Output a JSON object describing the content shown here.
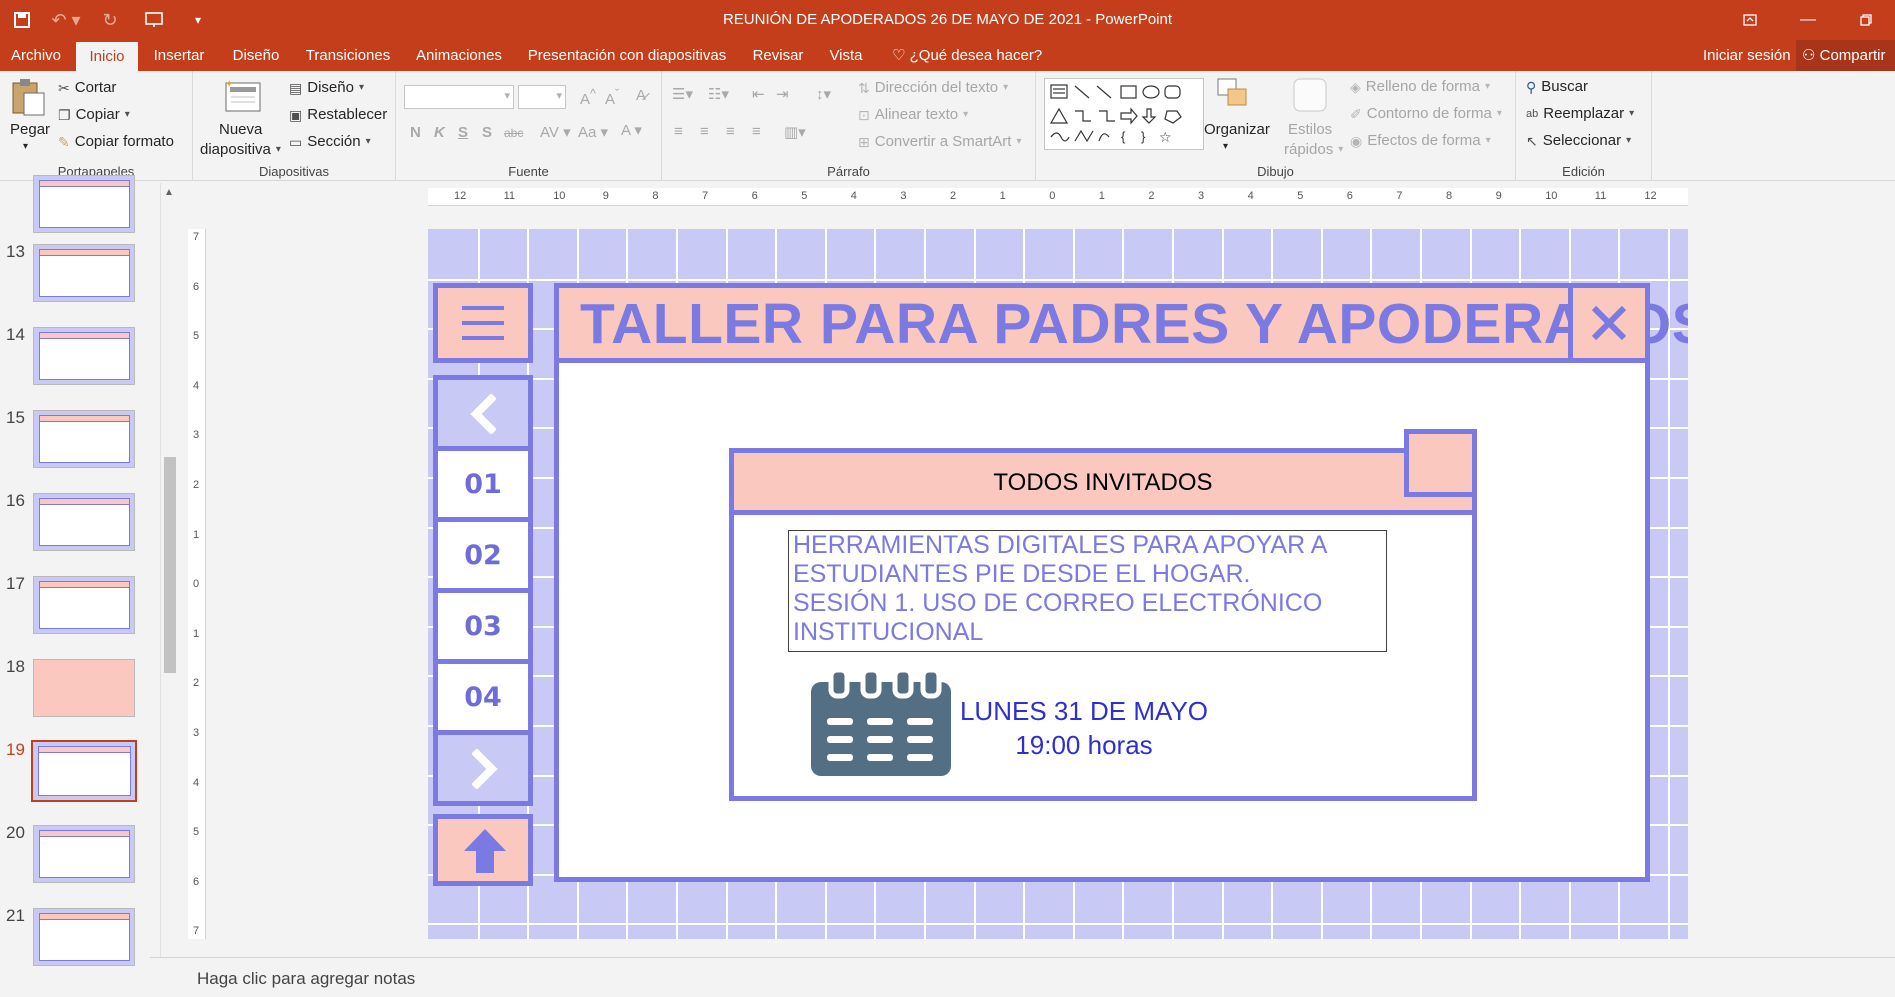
{
  "window": {
    "title": "REUNIÓN DE APODERADOS 26 DE MAYO DE 2021 - PowerPoint",
    "sign_in": "Iniciar sesión",
    "share": "Compartir"
  },
  "tabs": [
    "Archivo",
    "Inicio",
    "Insertar",
    "Diseño",
    "Transiciones",
    "Animaciones",
    "Presentación con diapositivas",
    "Revisar",
    "Vista"
  ],
  "active_tab": "Inicio",
  "tell_me": "¿Qué desea hacer?",
  "ribbon": {
    "clipboard": {
      "paste": "Pegar",
      "cut": "Cortar",
      "copy": "Copiar",
      "format_painter": "Copiar formato",
      "label": "Portapapeles"
    },
    "slides": {
      "new_slide_1": "Nueva",
      "new_slide_2": "diapositiva",
      "layout": "Diseño",
      "reset": "Restablecer",
      "section": "Sección",
      "label": "Diapositivas"
    },
    "font": {
      "label": "Fuente"
    },
    "paragraph": {
      "text_direction": "Dirección del texto",
      "align_text": "Alinear texto",
      "smartart": "Convertir a SmartArt",
      "label": "Párrafo"
    },
    "drawing": {
      "arrange": "Organizar",
      "quick_styles_1": "Estilos",
      "quick_styles_2": "rápidos",
      "shape_fill": "Relleno de forma",
      "shape_outline": "Contorno de forma",
      "shape_effects": "Efectos de forma",
      "label": "Dibujo"
    },
    "editing": {
      "find": "Buscar",
      "replace": "Reemplazar",
      "select": "Seleccionar",
      "label": "Edición"
    }
  },
  "ruler": {
    "horizontal": [
      "12",
      "11",
      "10",
      "9",
      "8",
      "7",
      "6",
      "5",
      "4",
      "3",
      "2",
      "1",
      "0",
      "1",
      "2",
      "3",
      "4",
      "5",
      "6",
      "7",
      "8",
      "9",
      "10",
      "11",
      "12"
    ],
    "vertical": [
      "7",
      "6",
      "5",
      "4",
      "3",
      "2",
      "1",
      "0",
      "1",
      "2",
      "3",
      "4",
      "5",
      "6",
      "7"
    ]
  },
  "thumbnails": [
    {
      "num": "13"
    },
    {
      "num": "14"
    },
    {
      "num": "15"
    },
    {
      "num": "16"
    },
    {
      "num": "17"
    },
    {
      "num": "18"
    },
    {
      "num": "19",
      "active": true
    },
    {
      "num": "20"
    },
    {
      "num": "21"
    }
  ],
  "slide": {
    "title": "TALLER PARA PADRES Y APODERADOS",
    "nav_numbers": [
      "01",
      "02",
      "03",
      "04"
    ],
    "card_header": "TODOS INVITADOS",
    "text_lines": [
      "HERRAMIENTAS DIGITALES PARA APOYAR A",
      "ESTUDIANTES PIE DESDE EL HOGAR.",
      "SESIÓN 1. USO DE CORREO ELECTRÓNICO",
      "INSTITUCIONAL"
    ],
    "date": "LUNES 31 DE MAYO",
    "time": "19:00 horas"
  },
  "notes_placeholder": "Haga clic para agregar notas",
  "colors": {
    "accent": "#c43e1c",
    "slide_bg": "#c9c9f5",
    "slide_border": "#7b79e2",
    "pink": "#fbc8c0",
    "calendar": "#546e84",
    "date_text": "#2f2fd0"
  }
}
